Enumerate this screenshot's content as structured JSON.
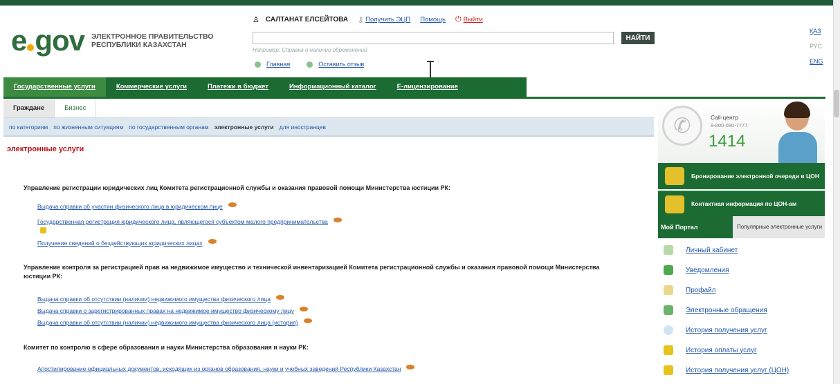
{
  "header": {
    "logo_mark": "e gov",
    "logo_e": "e",
    "logo_gov": "gov",
    "logo_line1": "ЭЛЕКТРОННОЕ ПРАВИТЕЛЬСТВО",
    "logo_line2": "РЕСПУБЛИКИ КАЗАХСТАН",
    "user_name": "САЛТАНАТ ЕЛСЕЙТОВА",
    "get_eds": "Получить ЭЦП",
    "help": "Помощь",
    "logout": "Выйти",
    "search_value": "",
    "search_button": "НАЙТИ",
    "search_hint": "Например: Справка о наличии обременений",
    "home": "Главная",
    "feedback": "Оставить отзыв",
    "langs": [
      "ҚАЗ",
      "РУС",
      "ENG"
    ]
  },
  "mainnav": [
    "Государственные услуги",
    "Коммерческие услуги",
    "Платежи в бюджет",
    "Информационный каталог",
    "Е-лицензирование"
  ],
  "subtabs": [
    "Граждане",
    "Бизнес"
  ],
  "filters": [
    "по категориям",
    "по жизненным ситуациям",
    "по государственным органам",
    "электронные услуги",
    "для иностранцев"
  ],
  "section_title": "электронные услуги",
  "groups": [
    {
      "title": "Управление регистрации юридических лиц Комитета регистрационной службы и оказания правовой помощи Министерства юстиции РК:",
      "links": [
        "Выдача справки об участии физического лица в юридическом лице",
        "Государственная регистрация юридического лица, являющегося субъектом малого предпринимательства",
        "Получение сведений о бездействующих юридических лицах"
      ]
    },
    {
      "title": "Управление контроля за регистрацией прав на недвижимое имущество и технической инвентаризацией Комитета регистрационной службы и оказания правовой помощи Министерства юстиции РК:",
      "links": [
        "Выдача справки об отсутствии (наличии) недвижимого имущества физического лица",
        "Выдача справки о зарегистрированных правах на недвижимое имущество физическому лицу",
        "Выдача справки об отсутствии (наличии) недвижимого имущества физического лица (история)"
      ]
    },
    {
      "title": "Комитет по контролю в сфере образования и науки Министерства образования и науки РК:",
      "links": [
        "Апостилирование официальных документов, исходящих из органов образования, науки и учебных заведений Республики Казахстан"
      ]
    }
  ],
  "sidebar": {
    "call_center": "Call-центр",
    "call_phone": "8-800-080-7777",
    "call_short": "1414",
    "booking": "Бронирование электронной очереди в ЦОН",
    "contacts": "Контактная информация по ЦОН-ам",
    "tab_portal": "Мой Портал",
    "tab_popular": "Популярные электронные услуги",
    "portal_links": [
      "Личный кабинет",
      "Уведомления",
      "Профайл",
      "Электронные обращения",
      "История получения услуг",
      "История оплаты услуг",
      "История получения услуг (ЦОН)"
    ]
  },
  "colors": {
    "brand_green": "#1c6b33",
    "accent_red": "#b8141b",
    "link_blue": "#2255aa"
  }
}
